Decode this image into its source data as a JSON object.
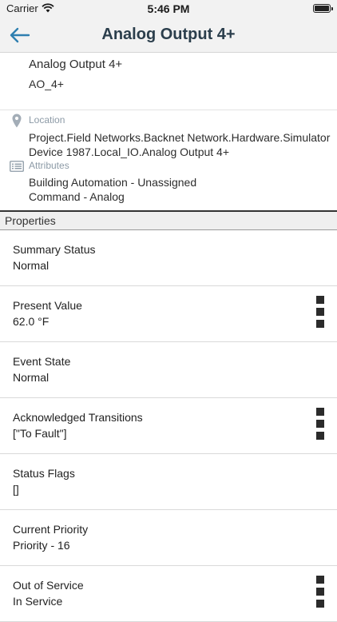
{
  "status_bar": {
    "carrier": "Carrier",
    "time": "5:46 PM"
  },
  "nav": {
    "title": "Analog Output 4+"
  },
  "object": {
    "name": "Analog Output 4+",
    "id": "AO_4+"
  },
  "location": {
    "label": "Location",
    "line1": "Project.Field Networks.Backnet Network.Hardware.Simulator",
    "line2": "Device 1987.Local_IO.Analog Output 4+"
  },
  "attributes": {
    "label": "Attributes",
    "line1": "Building Automation - Unassigned",
    "line2": "Command - Analog"
  },
  "properties": {
    "title": "Properties",
    "items": [
      {
        "label": "Summary Status",
        "value": "Normal"
      },
      {
        "label": "Present Value",
        "value": "62.0 °F"
      },
      {
        "label": "Event State",
        "value": "Normal"
      },
      {
        "label": "Acknowledged Transitions",
        "value": "[\"To Fault\"]"
      },
      {
        "label": "Status Flags",
        "value": "[]"
      },
      {
        "label": "Current Priority",
        "value": "Priority - 16"
      },
      {
        "label": "Out of Service",
        "value": "In Service"
      }
    ]
  },
  "colors": {
    "accent": "#2f7fb0",
    "title": "#2b3e4c",
    "muted": "#8c9aa6"
  }
}
